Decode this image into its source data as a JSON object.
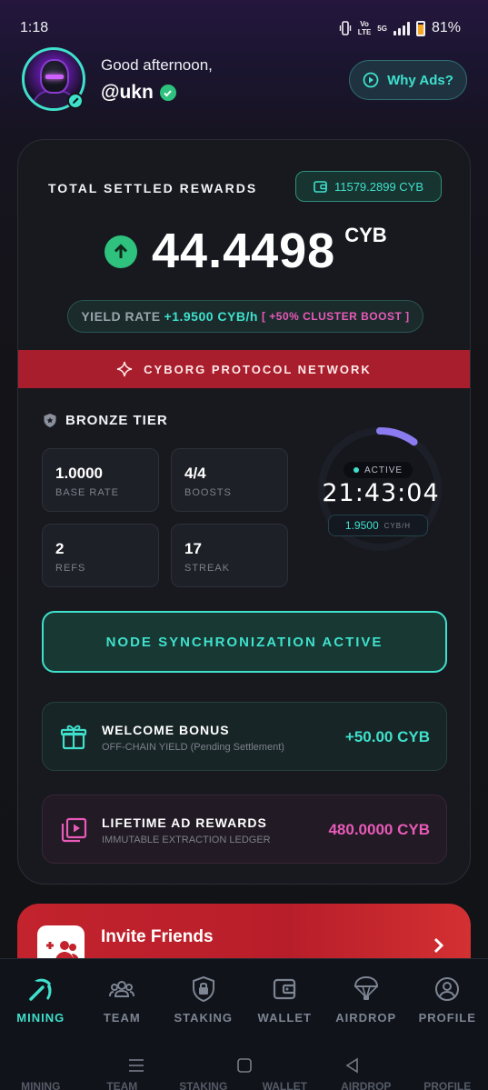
{
  "status_bar": {
    "time": "1:18",
    "volte_top": "Vo",
    "volte_bottom": "LTE",
    "network": "5G",
    "battery": "81%"
  },
  "header": {
    "greeting": "Good afternoon,",
    "username": "@ukn",
    "why_ads_label": "Why Ads?"
  },
  "rewards": {
    "label": "TOTAL SETTLED REWARDS",
    "wallet_balance": "11579.2899 CYB",
    "amount": "44.4498",
    "unit": "CYB",
    "yield_label": "YIELD RATE",
    "yield_value": "+1.9500 CYB/h",
    "boost_open": "[",
    "boost_text": "+50% CLUSTER BOOST",
    "boost_close": "]"
  },
  "banner": {
    "text": "CYBORG PROTOCOL NETWORK"
  },
  "tier": {
    "name": "BRONZE TIER",
    "stats": [
      {
        "value": "1.0000",
        "label": "BASE RATE"
      },
      {
        "value": "4/4",
        "label": "BOOSTS"
      },
      {
        "value": "2",
        "label": "REFS"
      },
      {
        "value": "17",
        "label": "STREAK"
      }
    ]
  },
  "timer": {
    "status": "ACTIVE",
    "countdown": "21:43:04",
    "rate": "1.9500",
    "rate_unit": "CYB/H",
    "progress": 0.1
  },
  "node_button": {
    "label": "NODE SYNCHRONIZATION ACTIVE"
  },
  "welcome_bonus": {
    "title": "WELCOME BONUS",
    "subtitle": "OFF-CHAIN YIELD (Pending Settlement)",
    "value": "+50.00 CYB"
  },
  "lifetime_ads": {
    "title": "LIFETIME AD REWARDS",
    "subtitle": "IMMUTABLE EXTRACTION LEDGER",
    "value": "480.0000 CYB"
  },
  "invite": {
    "title": "Invite Friends"
  },
  "nav": {
    "items": [
      {
        "label": "MINING",
        "icon": "pickaxe-icon",
        "active": true
      },
      {
        "label": "TEAM",
        "icon": "team-icon",
        "active": false
      },
      {
        "label": "STAKING",
        "icon": "lock-shield-icon",
        "active": false
      },
      {
        "label": "WALLET",
        "icon": "wallet-icon",
        "active": false
      },
      {
        "label": "AIRDROP",
        "icon": "parachute-icon",
        "active": false
      },
      {
        "label": "PROFILE",
        "icon": "profile-icon",
        "active": false
      }
    ]
  },
  "colors": {
    "accent": "#3fe0cc",
    "green": "#2ec27e",
    "red_banner": "#a81e2c",
    "pink": "#e85ab8"
  }
}
